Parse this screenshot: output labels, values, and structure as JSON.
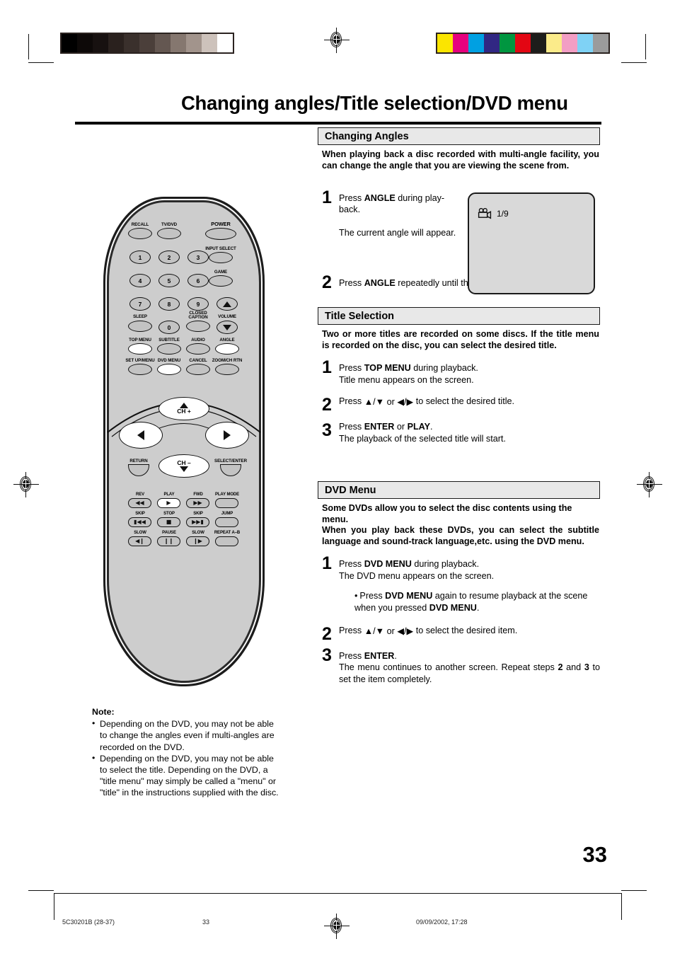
{
  "page": {
    "title": "Changing angles/Title selection/DVD menu",
    "number": "33"
  },
  "footer": {
    "doc_code": "5C30201B (28-37)",
    "page_label": "33",
    "timestamp": "09/09/2002, 17:28"
  },
  "sections": [
    {
      "heading": "Changing Angles",
      "intro": "When playing back a disc recorded with multi-angle facility, you can change the angle that you are viewing the scene from.",
      "steps": [
        {
          "num": "1",
          "line1_pre": "Press ",
          "line1_bold": "ANGLE",
          "line1_post": " during play-back.",
          "line2": "The current angle will appear."
        },
        {
          "num": "2",
          "pre": "Press ",
          "bold": "ANGLE",
          "post": " repeatedly until the desired angle is selected."
        }
      ]
    },
    {
      "heading": "Title Selection",
      "intro": "Two or more titles are recorded on some discs. If the title menu is recorded on the disc, you can select the desired title.",
      "steps": [
        {
          "num": "1",
          "pre": "Press ",
          "bold": "TOP MENU",
          "post": " during playback.",
          "sub": "Title menu appears on the screen."
        },
        {
          "num": "2",
          "pre": "Press ",
          "arrows": "▲/▼ or ◀/▶",
          "post": " to select the desired title."
        },
        {
          "num": "3",
          "pre": "Press ",
          "bold": "ENTER",
          "mid": " or ",
          "bold2": "PLAY",
          "post": ".",
          "sub": "The playback of the selected title will start."
        }
      ]
    },
    {
      "heading": "DVD Menu",
      "intro_line1": "Some DVDs allow you to select the disc contents using the menu.",
      "intro_line2": "When you play back these DVDs, you can select the subtitle language and sound-track language,etc. using the DVD menu.",
      "steps": [
        {
          "num": "1",
          "pre": "Press ",
          "bold": "DVD MENU",
          "post": " during playback.",
          "sub": "The DVD menu appears on the screen.",
          "bullet_pre": "Press ",
          "bullet_bold": "DVD MENU",
          "bullet_mid": " again to resume playback at the scene when you pressed ",
          "bullet_bold2": "DVD MENU",
          "bullet_post": "."
        },
        {
          "num": "2",
          "pre": "Press ",
          "arrows": "▲/▼ or ◀/▶",
          "post": " to select the desired item."
        },
        {
          "num": "3",
          "pre": "Press ",
          "bold": "ENTER",
          "post": ".",
          "sub_pre": "The menu continues to another screen. Repeat steps ",
          "sub_b1": "2",
          "sub_mid": " and ",
          "sub_b2": "3",
          "sub_post": " to set the item completely."
        }
      ]
    }
  ],
  "osd": {
    "icon": "movie-camera-icon",
    "angle_value": "1/9"
  },
  "note": {
    "heading": "Note:",
    "items": [
      "Depending on the DVD, you may not be able to change the angles even if multi-angles are recorded on the DVD.",
      "Depending on the DVD, you may not be able to select the title. Depending on the DVD, a \"title menu\" may simply be called a \"menu\" or \"title\" in the instructions supplied with the disc."
    ]
  },
  "remote": {
    "row_top": [
      {
        "label": "RECALL",
        "highlighted": false
      },
      {
        "label": "TV/DVD",
        "highlighted": false
      },
      {
        "label": "POWER",
        "highlighted": false
      }
    ],
    "side_right": [
      {
        "label": "INPUT SELECT",
        "highlighted": false
      },
      {
        "label": "GAME",
        "highlighted": false
      }
    ],
    "numeric": [
      "1",
      "2",
      "3",
      "4",
      "5",
      "6",
      "7",
      "8",
      "9",
      "0"
    ],
    "function_labels": [
      {
        "label": "SLEEP",
        "highlighted": false
      },
      {
        "label": "CLOSED CAPTION",
        "highlighted": false
      },
      {
        "label": "VOLUME",
        "highlighted": false
      },
      {
        "label": "TOP MENU",
        "highlighted": true
      },
      {
        "label": "SUBTITLE",
        "highlighted": false
      },
      {
        "label": "AUDIO",
        "highlighted": false
      },
      {
        "label": "ANGLE",
        "highlighted": true
      },
      {
        "label": "SET UP/MENU",
        "highlighted": false
      },
      {
        "label": "DVD MENU",
        "highlighted": true
      },
      {
        "label": "CANCEL",
        "highlighted": false
      },
      {
        "label": "ZOOM/CH RTN",
        "highlighted": false
      }
    ],
    "dpad": {
      "up": "CH +",
      "down": "CH –",
      "left_label": "RETURN",
      "right_label": "SELECT/ENTER"
    },
    "transport": [
      {
        "label": "REV",
        "glyph": "◀◀",
        "highlighted": false
      },
      {
        "label": "PLAY",
        "glyph": "▶",
        "highlighted": true
      },
      {
        "label": "FWD",
        "glyph": "▶▶",
        "highlighted": false
      },
      {
        "label": "PLAY MODE",
        "glyph": "",
        "highlighted": false
      },
      {
        "label": "SKIP",
        "glyph": "▮◀◀",
        "highlighted": false
      },
      {
        "label": "STOP",
        "glyph": "■",
        "highlighted": false
      },
      {
        "label": "SKIP",
        "glyph": "▶▶▮",
        "highlighted": false
      },
      {
        "label": "JUMP",
        "glyph": "",
        "highlighted": false
      },
      {
        "label": "SLOW",
        "glyph": "◀❙",
        "highlighted": false
      },
      {
        "label": "PAUSE",
        "glyph": "❙❙",
        "highlighted": false
      },
      {
        "label": "SLOW",
        "glyph": "❙▶",
        "highlighted": false
      },
      {
        "label": "REPEAT A–B",
        "glyph": "",
        "highlighted": false
      }
    ]
  },
  "calibration": {
    "grayscale": [
      "#000000",
      "#0d0908",
      "#171110",
      "#2a211e",
      "#3a302c",
      "#4b3f3a",
      "#645751",
      "#85776f",
      "#a2948c",
      "#cdc2bb",
      "#ffffff"
    ],
    "colors": [
      "#fbe500",
      "#e6007e",
      "#00a0e2",
      "#312783",
      "#009640",
      "#e30613",
      "#1d1d1b",
      "#fbeb8a",
      "#f29ec4",
      "#7fd2f5",
      "#9b9b9b"
    ]
  }
}
